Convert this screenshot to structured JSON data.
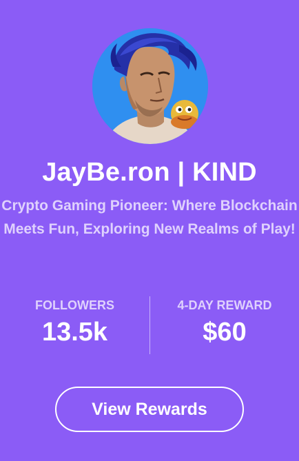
{
  "profile": {
    "name": "JayBe.ron | KIND",
    "bio": "Crypto Gaming Pioneer: Where Blockchain Meets Fun, Exploring New Realms of Play!"
  },
  "stats": {
    "followers": {
      "label": "FOLLOWERS",
      "value": "13.5k"
    },
    "reward": {
      "label": "4-DAY REWARD",
      "value": "$60"
    }
  },
  "actions": {
    "view_rewards_label": "View Rewards"
  },
  "colors": {
    "background": "#8b5cf6",
    "text_primary": "#ffffff",
    "text_muted": "rgba(255,255,255,0.72)",
    "avatar_bg": "#2f8ff0"
  }
}
